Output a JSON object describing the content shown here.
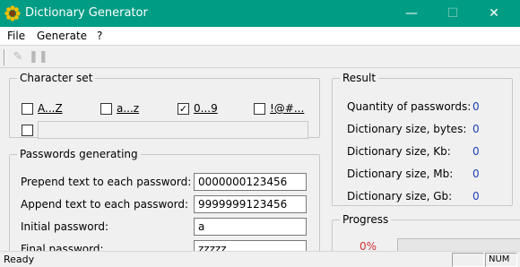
{
  "window": {
    "title": "Dictionary Generator",
    "icon": "sunflower-icon",
    "controls": {
      "minimize": "—",
      "maximize": "☐",
      "close": "✕"
    }
  },
  "menu": {
    "file": "File",
    "generate": "Generate",
    "help": "?"
  },
  "toolbar": {
    "buttons": [
      "pencil-icon",
      "pause-icon"
    ]
  },
  "charset": {
    "title": "Character set",
    "options": [
      {
        "label": "A...Z",
        "checked": false
      },
      {
        "label": "a...z",
        "checked": false
      },
      {
        "label": "0...9",
        "checked": true
      },
      {
        "label": "!@#...",
        "checked": false
      }
    ],
    "custom": {
      "checked": false,
      "value": ""
    }
  },
  "generating": {
    "title": "Passwords generating",
    "prepend_label": "Prepend text to each password:",
    "prepend_value": "0000000123456",
    "append_label": "Append text to each password:",
    "append_value": "9999999123456",
    "initial_label": "Initial password:",
    "initial_value": "a",
    "final_label": "Final password:",
    "final_value": "zzzzz"
  },
  "result": {
    "title": "Result",
    "rows": [
      {
        "label": "Quantity of passwords:",
        "value": "0"
      },
      {
        "label": "Dictionary size, bytes:",
        "value": "0"
      },
      {
        "label": "Dictionary size, Kb:",
        "value": "0"
      },
      {
        "label": "Dictionary size, Mb:",
        "value": "0"
      },
      {
        "label": "Dictionary size, Gb:",
        "value": "0"
      }
    ]
  },
  "progress": {
    "title": "Progress",
    "percent_text": "0%",
    "fraction": 0
  },
  "status": {
    "text": "Ready",
    "num": "NUM",
    "accent": "#009c84"
  }
}
